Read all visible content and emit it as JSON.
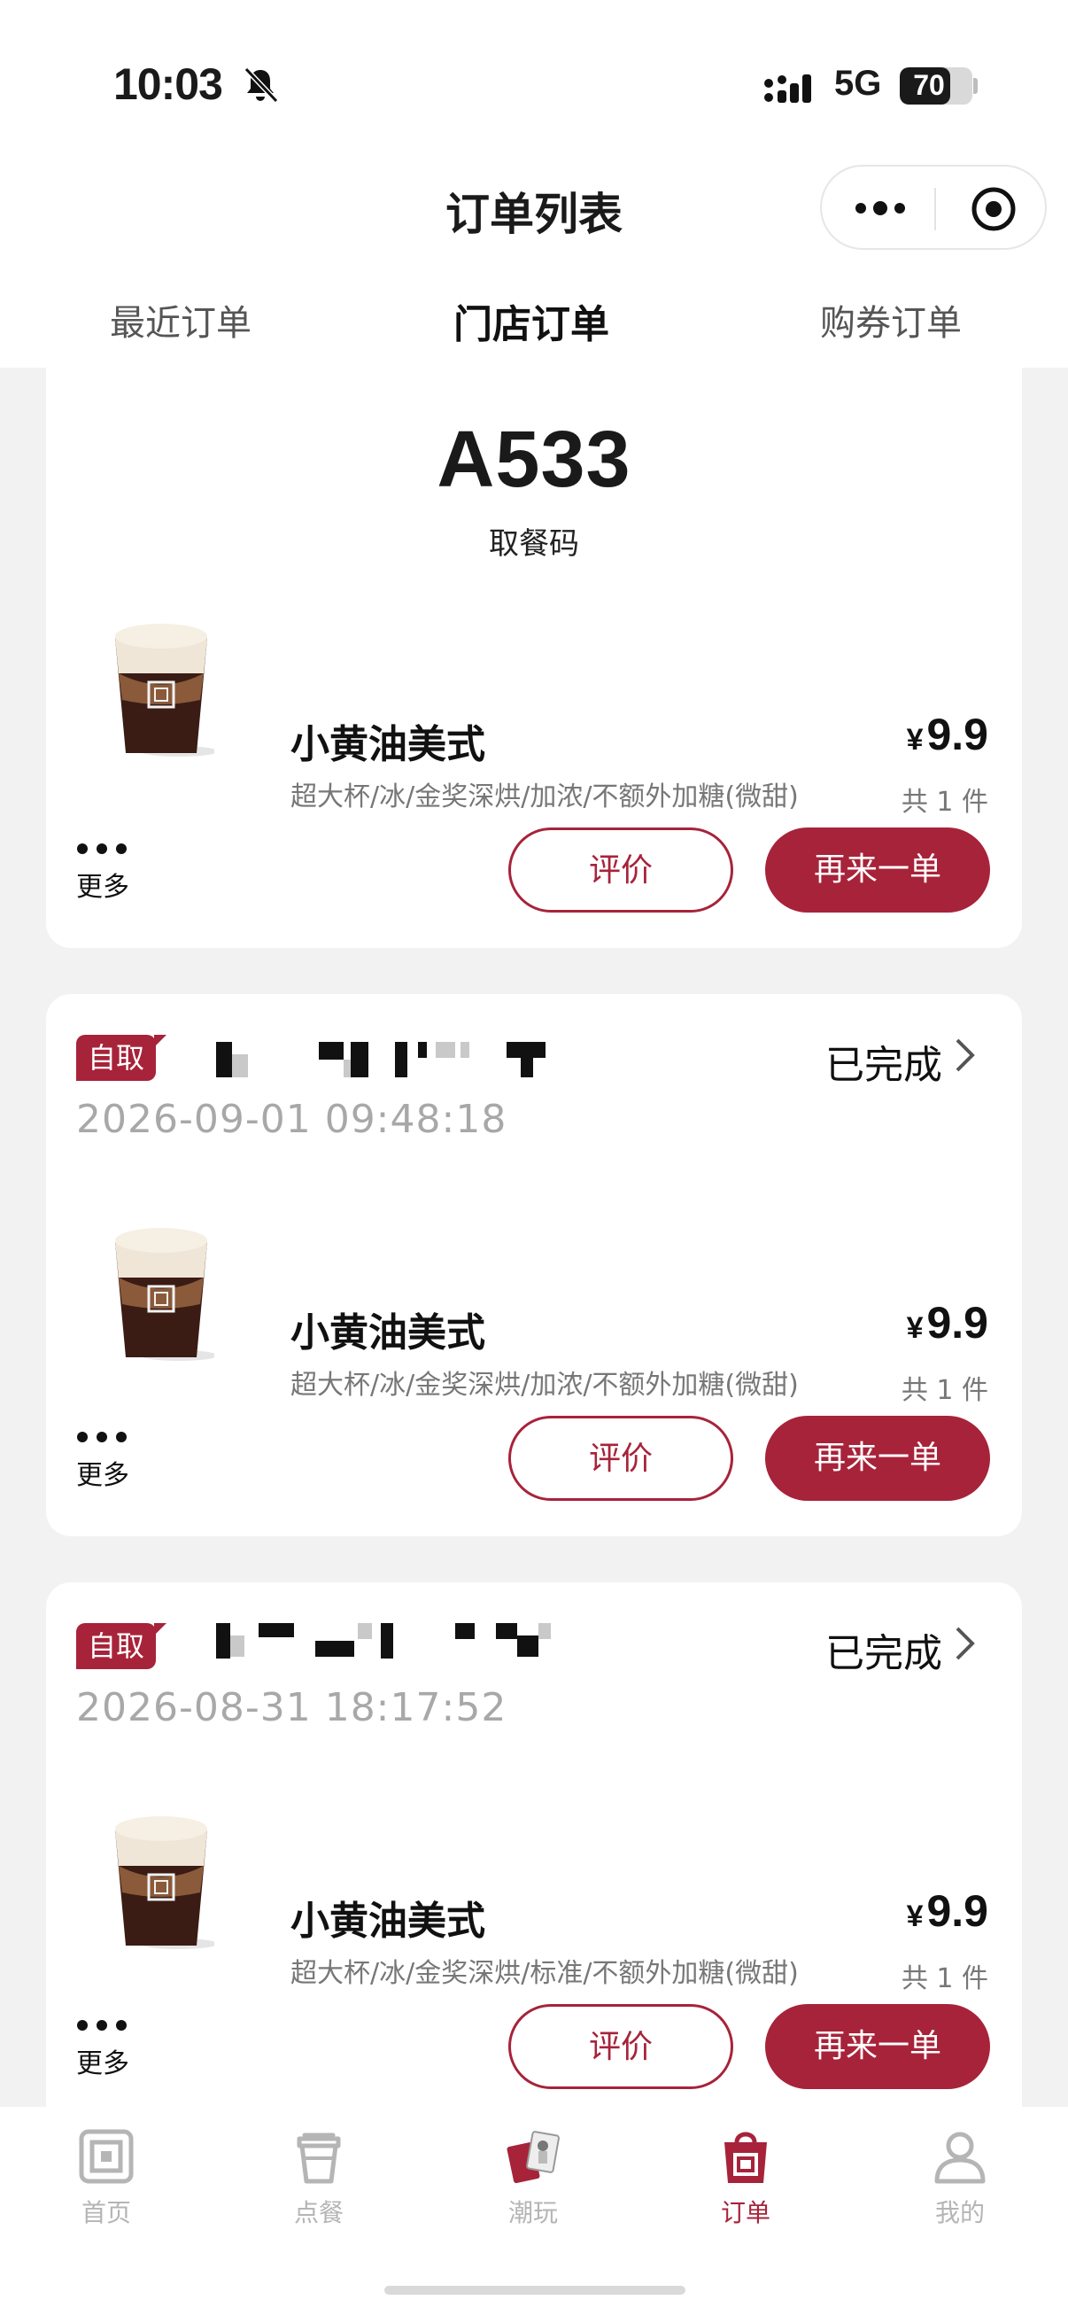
{
  "status_bar": {
    "time": "10:03",
    "network": "5G",
    "battery": "70",
    "battery_level": 0.7
  },
  "nav": {
    "title": "订单列表"
  },
  "tabs": [
    {
      "label": "最近订单"
    },
    {
      "label": "门店订单",
      "active": true
    },
    {
      "label": "购券订单"
    }
  ],
  "colors": {
    "accent": "#a7233a",
    "background": "#f2f2f2"
  },
  "orders": [
    {
      "pickup_code": "A533",
      "pickup_label": "取餐码",
      "product": {
        "name": "小黄油美式",
        "spec": "超大杯/冰/金奖深烘/加浓/不额外加糖(微甜)",
        "price_symbol": "¥",
        "price": "9.9",
        "qty": "共 1 件"
      },
      "more_label": "更多",
      "review_label": "评价",
      "reorder_label": "再来一单"
    },
    {
      "badge": "自取",
      "status": "已完成",
      "time": "2026-09-01 09:48:18",
      "product": {
        "name": "小黄油美式",
        "spec": "超大杯/冰/金奖深烘/加浓/不额外加糖(微甜)",
        "price_symbol": "¥",
        "price": "9.9",
        "qty": "共 1 件"
      },
      "more_label": "更多",
      "review_label": "评价",
      "reorder_label": "再来一单"
    },
    {
      "badge": "自取",
      "status": "已完成",
      "time": "2026-08-31 18:17:52",
      "product": {
        "name": "小黄油美式",
        "spec": "超大杯/冰/金奖深烘/标准/不额外加糖(微甜)",
        "price_symbol": "¥",
        "price": "9.9",
        "qty": "共 1 件"
      },
      "more_label": "更多",
      "review_label": "评价",
      "reorder_label": "再来一单"
    }
  ],
  "tabbar": [
    {
      "label": "首页",
      "icon": "home-icon"
    },
    {
      "label": "点餐",
      "icon": "cup-icon"
    },
    {
      "label": "潮玩",
      "icon": "toys-icon"
    },
    {
      "label": "订单",
      "icon": "order-bag-icon",
      "active": true
    },
    {
      "label": "我的",
      "icon": "profile-icon"
    }
  ]
}
